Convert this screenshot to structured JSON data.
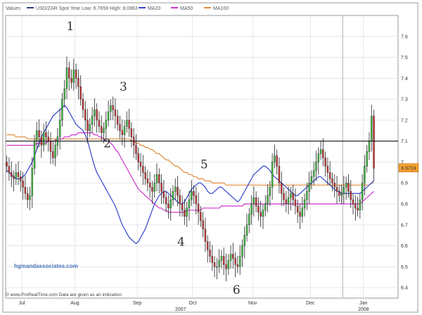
{
  "legend": {
    "values_label": "Values",
    "items": [
      {
        "label": "USD/ZAR Spot   Year Low: 6.7658 High: 8.0863",
        "color": "#2a3f7a"
      },
      {
        "label": "MA20",
        "color": "#3344cc"
      },
      {
        "label": "MA50",
        "color": "#cc33cc"
      },
      {
        "label": "MA100",
        "color": "#e08a3a"
      }
    ]
  },
  "watermark": "hgmandassociates.com",
  "footer": "© www.ProRealTime.com Data are given as an indication",
  "year_label": "2007",
  "chart_data": {
    "type": "candlestick",
    "series_name": "USD/ZAR Spot",
    "year_low": 6.7658,
    "year_high": 8.0863,
    "ylim": [
      6.35,
      7.7
    ],
    "yticks": [
      6.4,
      6.5,
      6.6,
      6.7,
      6.8,
      6.9,
      7.0,
      7.1,
      7.2,
      7.3,
      7.4,
      7.5,
      7.6
    ],
    "ytick_labels": [
      "6.4",
      "6.5",
      "6.6",
      "6.7",
      "6.8",
      "6.9",
      "7",
      "7.1",
      "7.2",
      "7.3",
      "7.4",
      "7.5",
      "7.6"
    ],
    "xlim": [
      0,
      170
    ],
    "month_ticks": [
      {
        "x": 7,
        "label": "Jul"
      },
      {
        "x": 30,
        "label": "Aug"
      },
      {
        "x": 57,
        "label": "Sep"
      },
      {
        "x": 81,
        "label": "Oct"
      },
      {
        "x": 107,
        "label": "Nov"
      },
      {
        "x": 132,
        "label": "Dec"
      },
      {
        "x": 155,
        "label": "Jan\n2008"
      }
    ],
    "last_price": "6.9724",
    "last_value": 6.9724,
    "resistance_level": 7.1,
    "cursor_x": 146,
    "wave_labels": [
      {
        "label": "1",
        "x": 28,
        "y": 7.63
      },
      {
        "label": "2",
        "x": 44,
        "y": 7.07
      },
      {
        "label": "3",
        "x": 51,
        "y": 7.34
      },
      {
        "label": "4",
        "x": 76,
        "y": 6.6
      },
      {
        "label": "5",
        "x": 86,
        "y": 6.97
      },
      {
        "label": "6",
        "x": 100,
        "y": 6.37
      }
    ],
    "ohlc_close": [
      6.98,
      6.95,
      6.93,
      6.92,
      6.95,
      6.93,
      6.91,
      6.88,
      6.85,
      6.82,
      6.84,
      6.97,
      7.1,
      7.15,
      7.12,
      7.08,
      7.14,
      7.12,
      7.1,
      7.05,
      7.02,
      7.08,
      7.12,
      7.2,
      7.3,
      7.35,
      7.45,
      7.4,
      7.38,
      7.44,
      7.4,
      7.36,
      7.3,
      7.25,
      7.2,
      7.15,
      7.18,
      7.22,
      7.25,
      7.2,
      7.17,
      7.14,
      7.16,
      7.2,
      7.24,
      7.27,
      7.25,
      7.22,
      7.18,
      7.15,
      7.13,
      7.17,
      7.2,
      7.16,
      7.12,
      7.08,
      7.04,
      7.0,
      6.98,
      6.95,
      6.92,
      6.9,
      6.88,
      6.86,
      6.9,
      6.94,
      6.9,
      6.86,
      6.83,
      6.8,
      6.78,
      6.82,
      6.86,
      6.88,
      6.84,
      6.8,
      6.77,
      6.74,
      6.78,
      6.82,
      6.86,
      6.84,
      6.8,
      6.76,
      6.72,
      6.68,
      6.62,
      6.58,
      6.55,
      6.52,
      6.5,
      6.5,
      6.53,
      6.55,
      6.51,
      6.49,
      6.53,
      6.56,
      6.54,
      6.51,
      6.5,
      6.55,
      6.6,
      6.65,
      6.7,
      6.75,
      6.8,
      6.83,
      6.79,
      6.76,
      6.74,
      6.77,
      6.8,
      6.84,
      6.88,
      7.0,
      7.03,
      6.98,
      6.9,
      6.85,
      6.82,
      6.8,
      6.83,
      6.85,
      6.82,
      6.79,
      6.76,
      6.74,
      6.78,
      6.82,
      6.86,
      6.9,
      6.93,
      6.96,
      7.0,
      7.04,
      7.06,
      7.02,
      6.98,
      6.95,
      6.92,
      6.9,
      6.88,
      6.86,
      6.84,
      6.85,
      6.88,
      6.9,
      6.86,
      6.82,
      6.8,
      6.78,
      6.77,
      6.82,
      6.9,
      6.98,
      7.05,
      7.1,
      7.22,
      6.97
    ],
    "ma20": [
      6.96,
      6.95,
      6.94,
      6.93,
      6.92,
      6.92,
      6.92,
      6.93,
      6.94,
      6.96,
      6.98,
      7.0,
      7.03,
      7.06,
      7.09,
      7.12,
      7.14,
      7.16,
      7.18,
      7.2,
      7.22,
      7.23,
      7.24,
      7.25,
      7.26,
      7.27,
      7.26,
      7.24,
      7.22,
      7.2,
      7.18,
      7.17,
      7.16,
      7.15,
      7.13,
      7.1,
      7.06,
      7.02,
      6.98,
      6.95,
      6.93,
      6.91,
      6.89,
      6.87,
      6.85,
      6.83,
      6.81,
      6.79,
      6.76,
      6.73,
      6.7,
      6.68,
      6.66,
      6.64,
      6.63,
      6.62,
      6.61,
      6.62,
      6.64,
      6.66,
      6.68,
      6.71,
      6.74,
      6.77,
      6.8,
      6.82,
      6.84,
      6.85,
      6.86,
      6.86,
      6.85,
      6.84,
      6.83,
      6.82,
      6.81,
      6.8,
      6.8,
      6.81,
      6.83,
      6.85,
      6.87,
      6.88,
      6.89,
      6.9,
      6.9,
      6.89,
      6.88,
      6.86,
      6.85,
      6.85,
      6.86,
      6.87,
      6.88,
      6.88,
      6.87,
      6.86,
      6.85,
      6.84,
      6.83,
      6.82,
      6.81,
      6.82,
      6.84,
      6.86,
      6.88,
      6.9,
      6.92,
      6.94,
      6.95,
      6.96,
      6.97,
      6.98,
      6.98,
      6.97,
      6.96,
      6.94,
      6.93,
      6.92,
      6.91,
      6.9,
      6.89,
      6.88,
      6.87,
      6.86,
      6.85,
      6.84,
      6.84,
      6.85,
      6.86,
      6.87,
      6.88,
      6.89,
      6.9,
      6.91,
      6.92,
      6.93,
      6.93,
      6.92,
      6.91,
      6.9,
      6.89,
      6.88,
      6.87,
      6.86,
      6.86,
      6.85,
      6.85,
      6.85,
      6.85,
      6.85,
      6.85,
      6.85,
      6.85,
      6.85,
      6.86,
      6.87,
      6.88,
      6.89,
      6.9,
      6.91
    ],
    "ma50": [
      7.08,
      7.08,
      7.08,
      7.08,
      7.08,
      7.08,
      7.08,
      7.08,
      7.08,
      7.08,
      7.08,
      7.08,
      7.08,
      7.09,
      7.09,
      7.09,
      7.09,
      7.09,
      7.1,
      7.1,
      7.1,
      7.1,
      7.11,
      7.11,
      7.11,
      7.12,
      7.12,
      7.12,
      7.13,
      7.13,
      7.13,
      7.14,
      7.14,
      7.14,
      7.14,
      7.14,
      7.14,
      7.14,
      7.13,
      7.13,
      7.12,
      7.12,
      7.11,
      7.1,
      7.1,
      7.09,
      7.08,
      7.06,
      7.05,
      7.03,
      7.01,
      6.99,
      6.97,
      6.95,
      6.93,
      6.91,
      6.89,
      6.87,
      6.86,
      6.85,
      6.84,
      6.83,
      6.82,
      6.81,
      6.8,
      6.79,
      6.78,
      6.78,
      6.77,
      6.77,
      6.76,
      6.76,
      6.76,
      6.76,
      6.76,
      6.76,
      6.76,
      6.76,
      6.77,
      6.77,
      6.77,
      6.77,
      6.77,
      6.77,
      6.77,
      6.78,
      6.78,
      6.78,
      6.78,
      6.78,
      6.78,
      6.78,
      6.78,
      6.79,
      6.79,
      6.79,
      6.79,
      6.79,
      6.79,
      6.79,
      6.79,
      6.79,
      6.79,
      6.8,
      6.8,
      6.8,
      6.8,
      6.8,
      6.8,
      6.8,
      6.8,
      6.8,
      6.8,
      6.8,
      6.8,
      6.8,
      6.8,
      6.8,
      6.8,
      6.8,
      6.8,
      6.8,
      6.8,
      6.8,
      6.8,
      6.8,
      6.8,
      6.8,
      6.8,
      6.8,
      6.8,
      6.8,
      6.8,
      6.8,
      6.8,
      6.8,
      6.8,
      6.8,
      6.8,
      6.8,
      6.8,
      6.8,
      6.8,
      6.8,
      6.8,
      6.8,
      6.8,
      6.8,
      6.8,
      6.8,
      6.8,
      6.8,
      6.8,
      6.8,
      6.81,
      6.82,
      6.83,
      6.84,
      6.85,
      6.86
    ],
    "ma100": [
      7.13,
      7.13,
      7.13,
      7.13,
      7.12,
      7.12,
      7.12,
      7.12,
      7.12,
      7.11,
      7.11,
      7.11,
      7.11,
      7.11,
      7.11,
      7.11,
      7.11,
      7.11,
      7.11,
      7.11,
      7.11,
      7.11,
      7.11,
      7.11,
      7.11,
      7.11,
      7.11,
      7.11,
      7.11,
      7.11,
      7.11,
      7.11,
      7.11,
      7.11,
      7.11,
      7.11,
      7.11,
      7.11,
      7.11,
      7.11,
      7.11,
      7.11,
      7.11,
      7.11,
      7.11,
      7.11,
      7.11,
      7.11,
      7.11,
      7.11,
      7.11,
      7.11,
      7.11,
      7.11,
      7.1,
      7.1,
      7.09,
      7.09,
      7.08,
      7.08,
      7.07,
      7.07,
      7.06,
      7.06,
      7.05,
      7.04,
      7.04,
      7.03,
      7.02,
      7.01,
      7.01,
      7.0,
      6.99,
      6.98,
      6.98,
      6.97,
      6.96,
      6.95,
      6.95,
      6.94,
      6.94,
      6.93,
      6.93,
      6.92,
      6.92,
      6.92,
      6.91,
      6.91,
      6.91,
      6.9,
      6.9,
      6.9,
      6.9,
      6.9,
      6.9,
      6.89,
      6.89,
      6.89,
      6.89,
      6.89,
      6.89,
      6.89,
      6.89,
      6.89,
      6.89,
      6.89,
      6.89,
      6.89,
      6.89,
      6.89,
      6.89,
      6.89,
      6.89,
      6.89,
      6.89,
      6.89,
      6.89,
      6.89,
      6.89,
      6.89,
      6.89,
      6.89,
      6.89,
      6.89,
      6.89,
      6.89,
      6.89,
      6.89,
      6.89,
      6.89,
      6.89,
      6.89,
      6.89,
      6.89,
      6.89,
      6.89,
      6.89,
      6.89,
      6.89,
      6.89,
      6.89,
      6.89,
      6.89,
      6.89,
      6.89,
      6.89,
      6.89,
      6.89,
      6.89,
      6.89,
      6.89,
      6.89,
      6.89,
      6.89,
      6.89,
      6.89,
      6.89,
      6.89,
      6.9,
      6.9
    ],
    "colors": {
      "up": "#3fbf3f",
      "down": "#c83838",
      "outline": "#222222",
      "grid": "#d4d8e0",
      "border": "#999999",
      "last_price_box": "#f2a030"
    }
  }
}
